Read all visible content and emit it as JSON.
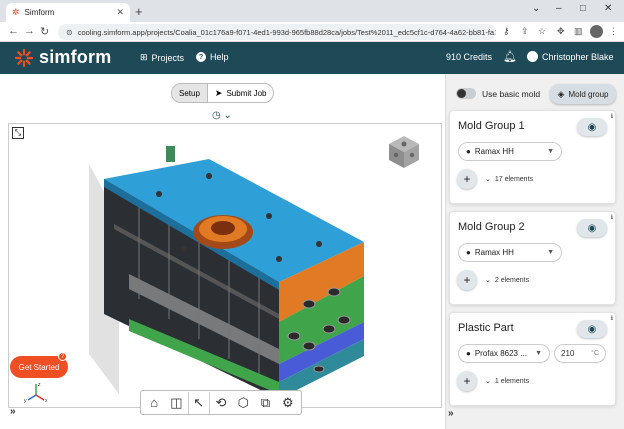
{
  "browser": {
    "tab_title": "Simform",
    "url": "cooling.simform.app/projects/Coalia_01c176a9-f071-4ed1-993d-965fb88d28ca/jobs/Test%2011_edc5cf1c-d764-4a62-bb81-fa1ed..."
  },
  "header": {
    "logo_text": "simform",
    "nav_projects": "Projects",
    "nav_help": "Help",
    "credits": "910 Credits",
    "user_name": "Christopher Blake"
  },
  "viewer": {
    "mode_setup": "Setup",
    "mode_submit": "Submit Job",
    "get_started": "Get Started",
    "get_started_badge": "?",
    "axes": {
      "x": "x",
      "y": "y",
      "z": "z"
    }
  },
  "sidebar": {
    "basic_mold_label": "Use basic mold",
    "basic_mold_on": false,
    "mold_group_button": "Mold group",
    "cards": [
      {
        "title": "Mold Group 1",
        "material": "Ramax HH",
        "elements": "17 elements"
      },
      {
        "title": "Mold Group 2",
        "material": "Ramax HH",
        "elements": "2 elements"
      },
      {
        "title": "Plastic Part",
        "material": "Profax 8623 ...",
        "temperature": "210",
        "temperature_unit": "°C",
        "elements": "1 elements"
      }
    ]
  },
  "colors": {
    "header_bg": "#1e4a57",
    "accent_orange": "#f04e23",
    "mold_blue": "#2f9fd8",
    "mold_orange": "#e07a24",
    "mold_green": "#3fa44a"
  }
}
